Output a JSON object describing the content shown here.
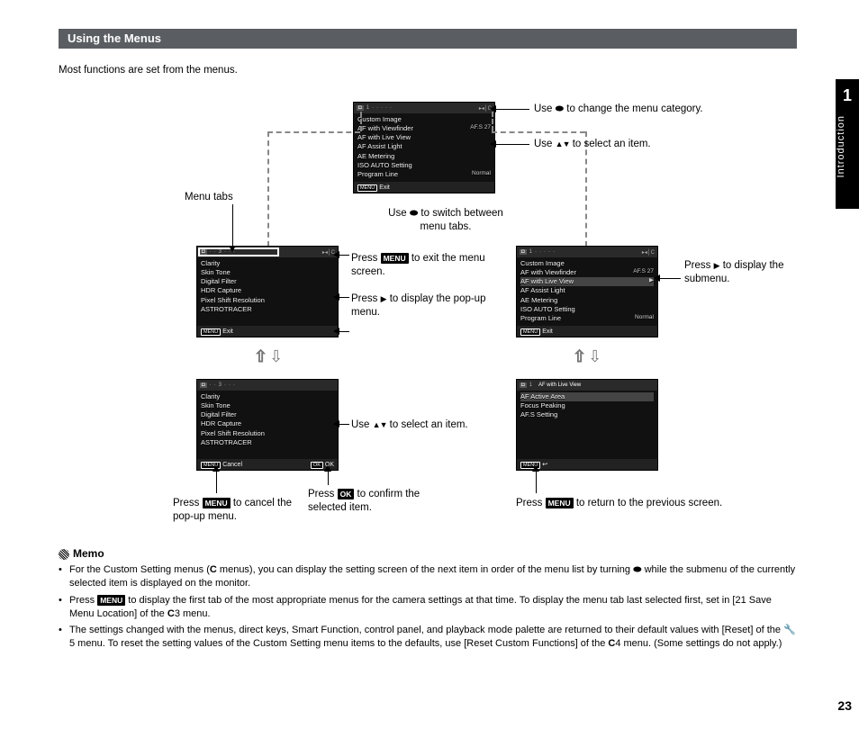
{
  "section_title": "Using the Menus",
  "intro": "Most functions are set from the menus.",
  "chapter_number": "1",
  "chapter_name": "Introduction",
  "page_number": "23",
  "callouts": {
    "menu_tabs_label": "Menu tabs",
    "change_category": "to change the menu category.",
    "change_category_prefix": "Use ",
    "select_item_prefix": "Use ",
    "select_item": "to select an item.",
    "switch_tabs": "to switch between menu tabs.",
    "switch_tabs_prefix": "Use ",
    "exit_menu_prefix": "Press ",
    "exit_menu": " to exit the menu screen.",
    "display_popup_prefix": "Press ",
    "display_popup": " to display the pop-up menu.",
    "display_submenu_prefix": "Press ",
    "display_submenu": " to display the submenu.",
    "select_item2_prefix": "Use ",
    "select_item2": " to select an item.",
    "cancel_popup_prefix": "Press ",
    "cancel_popup": " to cancel the pop-up menu.",
    "confirm_prefix": "Press ",
    "confirm": " to confirm the selected item.",
    "return_prev_prefix": "Press ",
    "return_prev": " to return to the previous screen.",
    "btn_menu": "MENU",
    "btn_ok": "OK"
  },
  "lcd_top": {
    "items": [
      {
        "l": "Custom Image",
        "r": ""
      },
      {
        "l": "AF with Viewfinder",
        "r": "AF.S 27"
      },
      {
        "l": "AF with Live View",
        "r": ""
      },
      {
        "l": "AF Assist Light",
        "r": ""
      },
      {
        "l": "AE Metering",
        "r": ""
      },
      {
        "l": "ISO AUTO Setting",
        "r": ""
      },
      {
        "l": "Program Line",
        "r": "Normal"
      }
    ],
    "foot_left": "Exit"
  },
  "lcd_left_upper": {
    "items": [
      {
        "l": "Clarity",
        "r": ""
      },
      {
        "l": "Skin Tone",
        "r": ""
      },
      {
        "l": "Digital Filter",
        "r": ""
      },
      {
        "l": "HDR Capture",
        "r": ""
      },
      {
        "l": "Pixel Shift Resolution",
        "r": ""
      },
      {
        "l": "ASTROTRACER",
        "r": ""
      }
    ],
    "foot_left": "Exit"
  },
  "lcd_left_lower": {
    "items": [
      {
        "l": "Clarity",
        "r": ""
      },
      {
        "l": "Skin Tone",
        "r": ""
      },
      {
        "l": "Digital Filter",
        "r": ""
      },
      {
        "l": "HDR Capture",
        "r": ""
      },
      {
        "l": "Pixel Shift Resolution",
        "r": ""
      },
      {
        "l": "ASTROTRACER",
        "r": ""
      }
    ],
    "foot_left": "Cancel",
    "foot_right": "OK"
  },
  "lcd_right_upper": {
    "items": [
      {
        "l": "Custom Image",
        "r": ""
      },
      {
        "l": "AF with Viewfinder",
        "r": "AF.S 27"
      },
      {
        "l": "AF with Live View",
        "r": "▶",
        "sel": true
      },
      {
        "l": "AF Assist Light",
        "r": ""
      },
      {
        "l": "AE Metering",
        "r": ""
      },
      {
        "l": "ISO AUTO Setting",
        "r": ""
      },
      {
        "l": "Program Line",
        "r": "Normal"
      }
    ],
    "foot_left": "Exit"
  },
  "lcd_right_lower": {
    "title": "AF with Live View",
    "items": [
      {
        "l": "AF Active Area",
        "r": "",
        "sel": true
      },
      {
        "l": "Focus Peaking",
        "r": ""
      },
      {
        "l": "AF.S Setting",
        "r": ""
      }
    ],
    "foot_left": ""
  },
  "memo_title": "Memo",
  "memo": {
    "b1a": "For the Custom Setting menus (",
    "b1b": " menus), you can display the setting screen of the next item in order of the menu list by turning ",
    "b1c": " while the submenu of the currently selected item is displayed on the monitor.",
    "b2a": "Press ",
    "b2b": " to display the first tab of the most appropriate menus for the camera settings at that time. To display the menu tab last selected first, set in [21 Save Menu Location] of the ",
    "b2c": "3 menu.",
    "b3a": "The settings changed with the menus, direct keys, Smart Function, control panel, and playback mode palette are returned to their default values with [Reset] of the ",
    "b3b": "5 menu. To reset the setting values of the Custom Setting menu items to the defaults, use [Reset Custom Functions] of the ",
    "b3c": "4 menu. (Some settings do not apply.)",
    "sym_C": "C",
    "sym_wrench": "🔧"
  }
}
